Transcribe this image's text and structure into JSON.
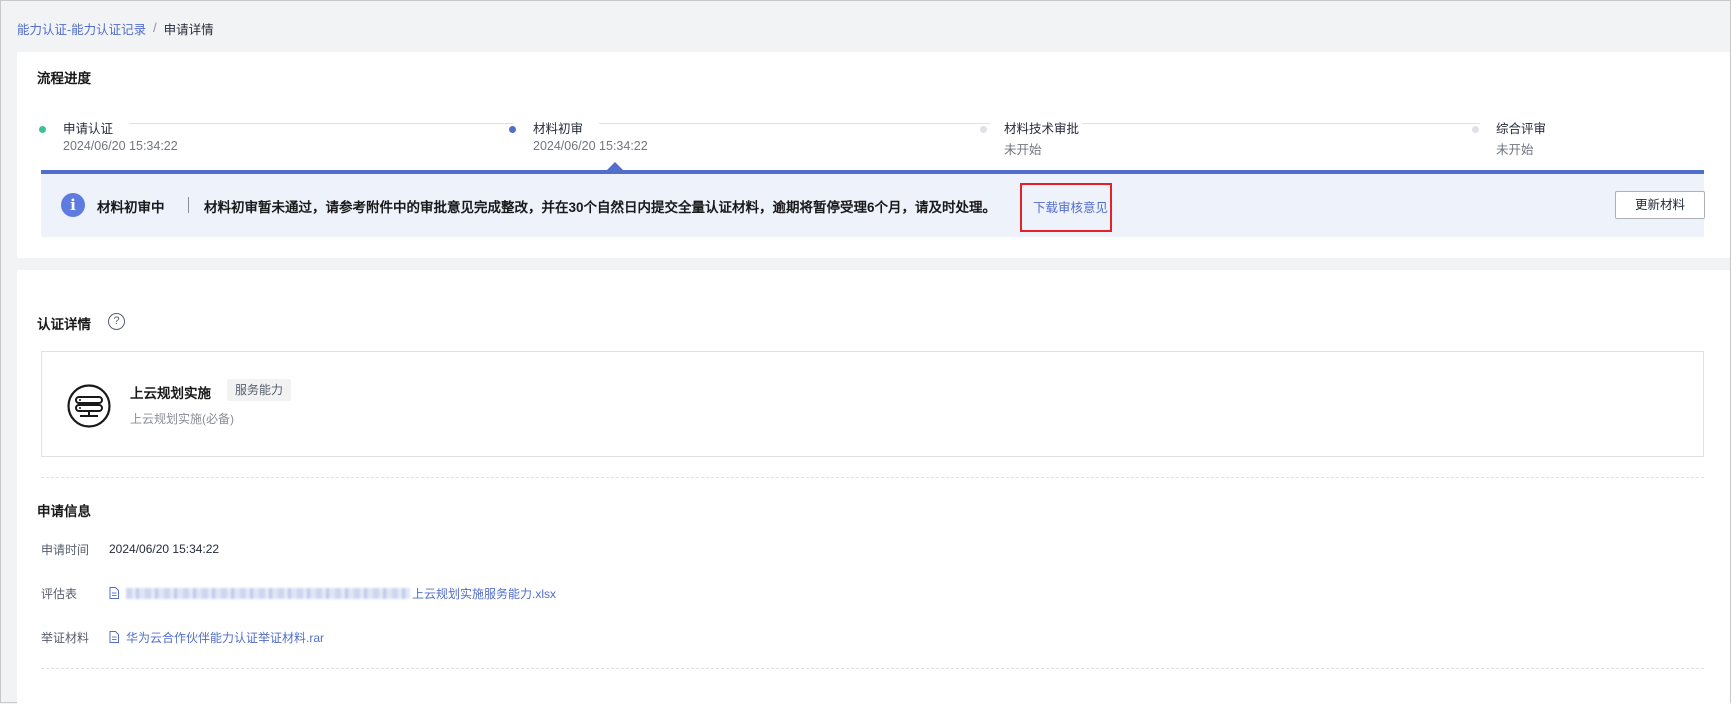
{
  "breadcrumb": {
    "parent": "能力认证-能力认证记录",
    "separator": "/",
    "current": "申请详情"
  },
  "progress": {
    "title": "流程进度",
    "steps": [
      {
        "label": "申请认证",
        "time": "2024/06/20 15:34:22",
        "state": "done",
        "color": "#3ac295"
      },
      {
        "label": "材料初审",
        "time": "2024/06/20 15:34:22",
        "state": "current",
        "color": "#526ecc"
      },
      {
        "label": "材料技术审批",
        "time": "未开始",
        "state": "pending",
        "color": "#dfe1e6"
      },
      {
        "label": "综合评审",
        "time": "未开始",
        "state": "pending",
        "color": "#dfe1e6"
      }
    ],
    "notice": {
      "status": "材料初审中",
      "message": "材料初审暂未通过，请参考附件中的审批意见完成整改，并在30个自然日内提交全量认证材料，逾期将暂停受理6个月，请及时处理。",
      "link": "下载审核意见",
      "button": "更新材料"
    }
  },
  "detail": {
    "title": "认证详情",
    "help_icon": "?",
    "capability": {
      "name": "上云规划实施",
      "tag": "服务能力",
      "subtitle": "上云规划实施(必备)",
      "icon": "server-stack-icon"
    },
    "apply_info": {
      "title": "申请信息",
      "rows": [
        {
          "key": "申请时间",
          "value": "2024/06/20 15:34:22"
        },
        {
          "key": "评估表",
          "value": "上云规划实施服务能力.xlsx"
        },
        {
          "key": "举证材料",
          "value": "华为云合作伙伴能力认证举证材料.rar"
        }
      ]
    }
  },
  "colors": {
    "accent": "#526ecc",
    "highlight": "#e6212a"
  }
}
